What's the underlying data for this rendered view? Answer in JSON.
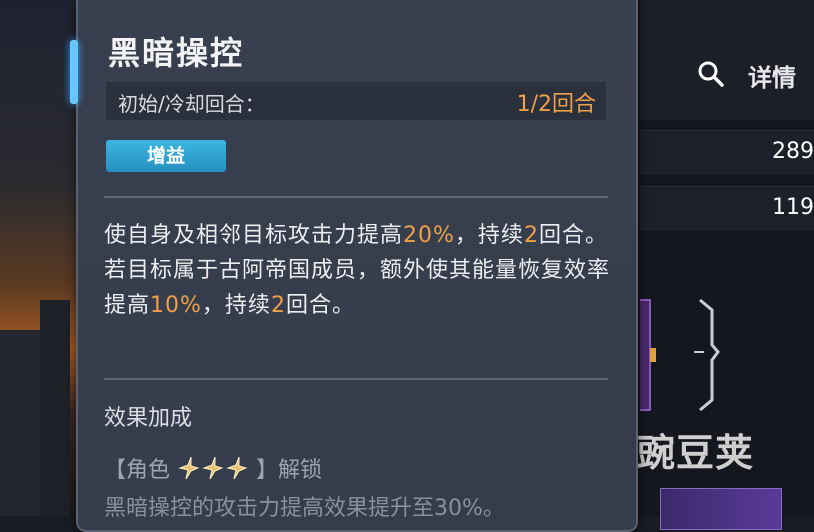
{
  "skill": {
    "name": "黑暗操控",
    "cooldown_label": "初始/冷却回合：",
    "cooldown_value": "1/2回合",
    "tag": "增益",
    "description_parts": [
      {
        "text": "使自身及相邻目标攻击力提高",
        "hl": false
      },
      {
        "text": "20%",
        "hl": true
      },
      {
        "text": "，持续",
        "hl": false
      },
      {
        "text": "2",
        "hl": true
      },
      {
        "text": "回合。若目标属于古阿帝国成员，额外使其能量恢复效率提高",
        "hl": false
      },
      {
        "text": "10%",
        "hl": true
      },
      {
        "text": "，持续",
        "hl": false
      },
      {
        "text": "2",
        "hl": true
      },
      {
        "text": "回合。",
        "hl": false
      }
    ]
  },
  "bonus": {
    "title": "效果加成",
    "unlock_prefix": "【角色",
    "unlock_suffix": "】解锁",
    "stars": 3,
    "desc": "黑暗操控的攻击力提高效果提升至30%。"
  },
  "right_panel": {
    "details_label": "详情",
    "stat_1": "289",
    "stat_2": "119"
  },
  "watermark": {
    "text": "豌豆荚"
  },
  "colors": {
    "highlight": "#f0a046",
    "tag_bg": "#2ba2d4",
    "panel_bg": "#373e4d"
  }
}
